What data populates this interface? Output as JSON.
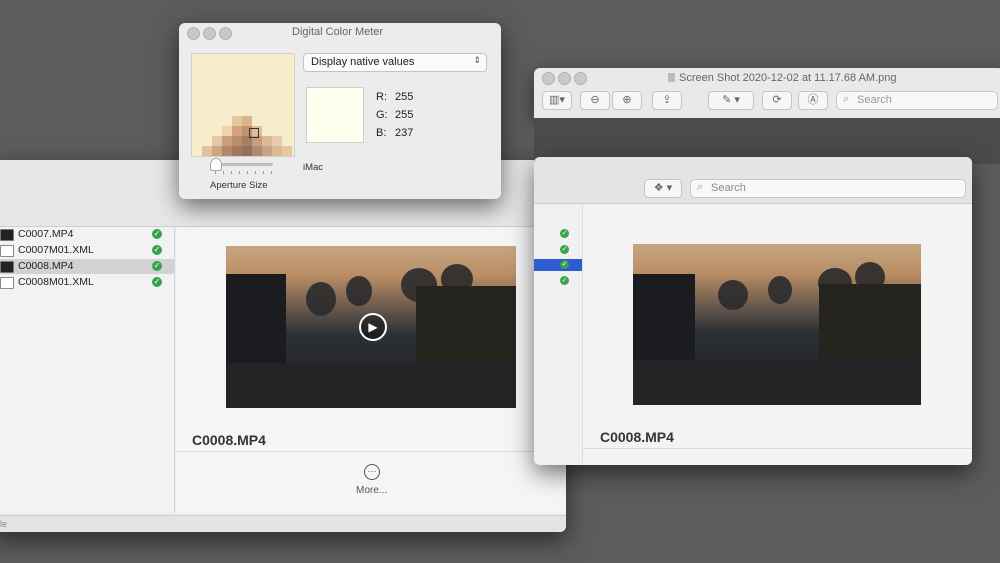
{
  "desktop": {
    "background": "#5b5c5d"
  },
  "finder": {
    "files": [
      {
        "name": "C0007.MP4",
        "type": "video",
        "synced": true,
        "selected": false
      },
      {
        "name": "C0007M01.XML",
        "type": "xml",
        "synced": true,
        "selected": false
      },
      {
        "name": "C0008.MP4",
        "type": "video",
        "synced": true,
        "selected": true
      },
      {
        "name": "C0008M01.XML",
        "type": "xml",
        "synced": true,
        "selected": false
      }
    ],
    "preview_filename": "C0008.MP4",
    "more_label": "More...",
    "status_text": "le"
  },
  "color_meter": {
    "title": "Digital Color Meter",
    "mode": "Display native values",
    "display_name": "iMac",
    "aperture_label": "Aperture Size",
    "r_label": "R:",
    "r_value": "255",
    "g_label": "G:",
    "g_value": "255",
    "b_label": "B:",
    "b_value": "237",
    "sampled_color": "#ffffed"
  },
  "preview_app": {
    "title": "Screen Shot 2020-12-02 at 11.17.68 AM.png",
    "search_placeholder": "Search",
    "icons": [
      "sidebar-icon",
      "zoom-out-icon",
      "zoom-in-icon",
      "share-icon",
      "markup-pen-icon",
      "rotate-icon",
      "annotate-icon"
    ]
  },
  "dropbox_window": {
    "search_placeholder": "Search",
    "preview_filename": "C0008.MP4",
    "accent": "#2d5bd1"
  }
}
